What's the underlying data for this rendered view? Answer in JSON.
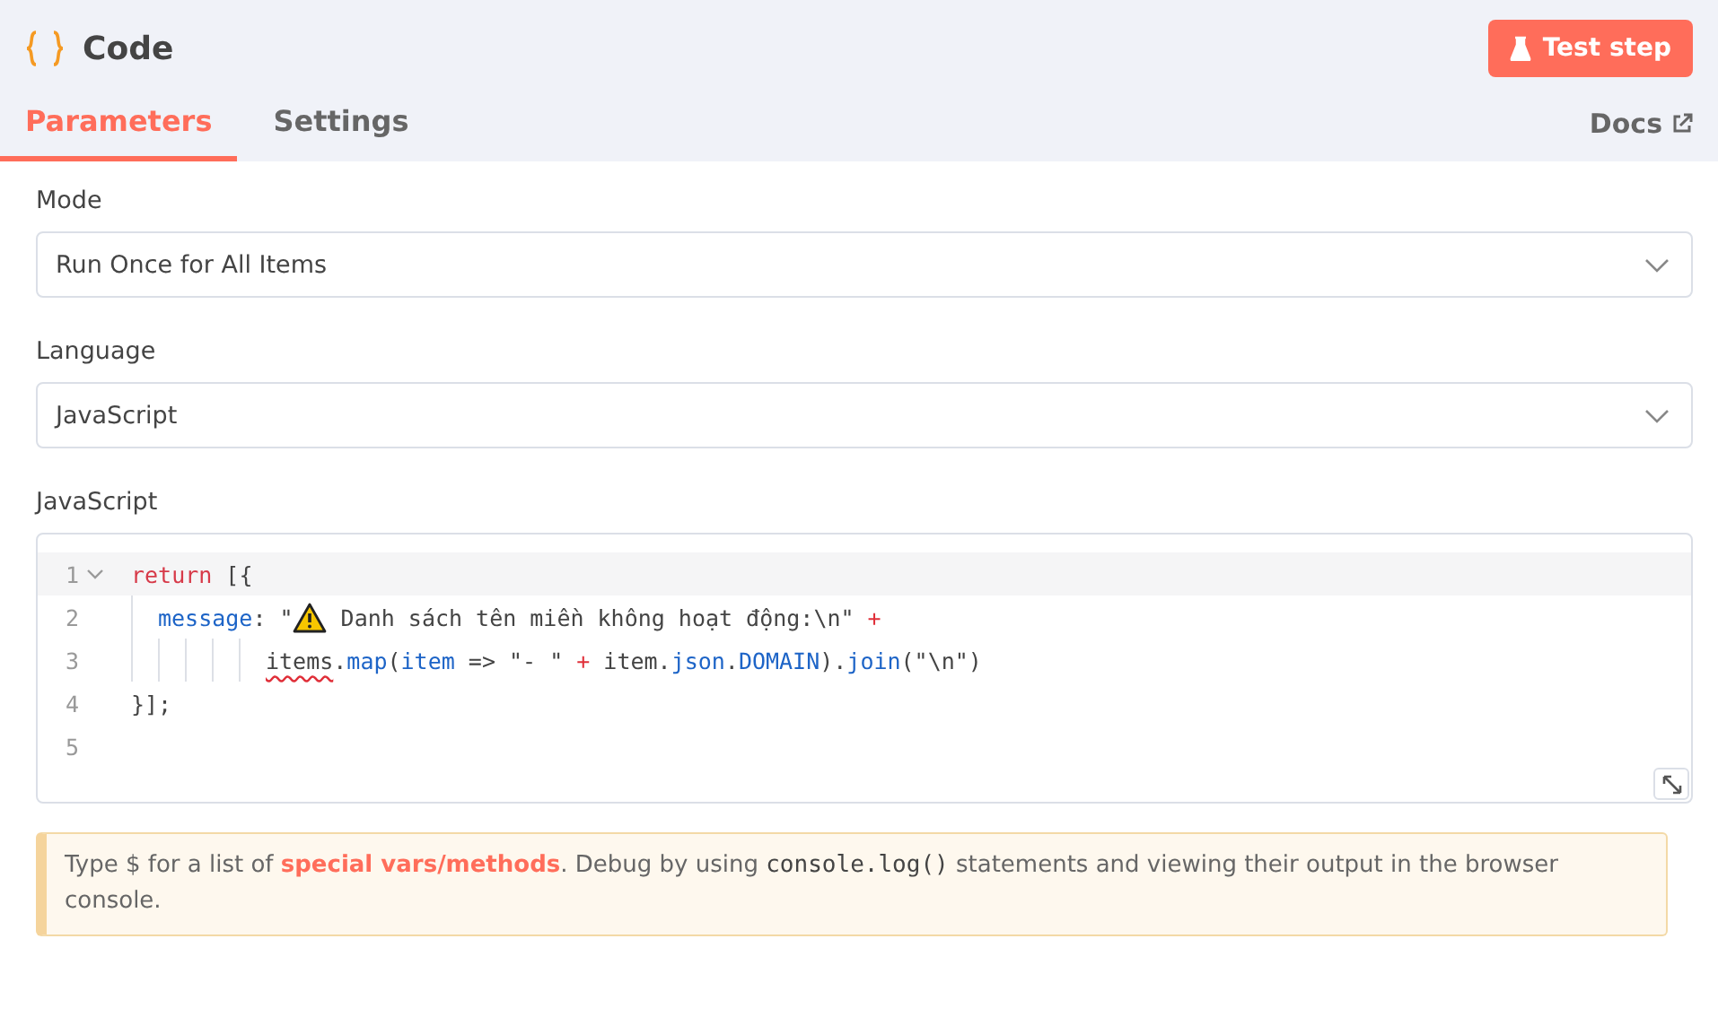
{
  "header": {
    "title": "Code",
    "test_button": "Test step"
  },
  "tabs": [
    {
      "label": "Parameters",
      "selected": true
    },
    {
      "label": "Settings",
      "selected": false
    }
  ],
  "docs_link": "Docs",
  "fields": [
    {
      "label": "Mode",
      "value": "Run Once for All Items"
    },
    {
      "label": "Language",
      "value": "JavaScript"
    }
  ],
  "editor": {
    "label": "JavaScript",
    "lines": [
      {
        "number": "1",
        "active": true,
        "foldable": true,
        "kind": "top",
        "tokens": [
          {
            "kind": "keyword",
            "text": "return"
          },
          {
            "kind": "plain",
            "text": " [{"
          }
        ]
      },
      {
        "number": "2",
        "active": false,
        "foldable": false,
        "kind": "nested",
        "tokens": [
          {
            "kind": "property",
            "text": "message"
          },
          {
            "kind": "plain",
            "text": ": \""
          },
          {
            "kind": "warning"
          },
          {
            "kind": "plain",
            "text": " Danh sách tên miền không hoạt động:\\n\" "
          },
          {
            "kind": "operator",
            "text": "+"
          }
        ]
      },
      {
        "number": "3",
        "active": false,
        "foldable": false,
        "kind": "continuation",
        "tokens": [
          {
            "kind": "error",
            "text": "items"
          },
          {
            "kind": "plain",
            "text": "."
          },
          {
            "kind": "property",
            "text": "map"
          },
          {
            "kind": "plain",
            "text": "("
          },
          {
            "kind": "property",
            "text": "item"
          },
          {
            "kind": "plain",
            "text": " => \"- \" "
          },
          {
            "kind": "operator",
            "text": "+"
          },
          {
            "kind": "plain",
            "text": " item."
          },
          {
            "kind": "property",
            "text": "json"
          },
          {
            "kind": "plain",
            "text": "."
          },
          {
            "kind": "property",
            "text": "DOMAIN"
          },
          {
            "kind": "plain",
            "text": ")."
          },
          {
            "kind": "property",
            "text": "join"
          },
          {
            "kind": "plain",
            "text": "(\"\\n\")"
          }
        ]
      },
      {
        "number": "4",
        "active": false,
        "foldable": false,
        "kind": "top",
        "tokens": [
          {
            "kind": "plain",
            "text": "}];"
          }
        ]
      },
      {
        "number": "5",
        "active": false,
        "foldable": false,
        "kind": "top"
      }
    ]
  },
  "hint": [
    {
      "kind": "text",
      "text": "Type $ for a list of "
    },
    {
      "kind": "link",
      "text": "special vars/methods"
    },
    {
      "kind": "text",
      "text": ". Debug by using "
    },
    {
      "kind": "code",
      "text": "console.log()"
    },
    {
      "kind": "text",
      "text": " statements and viewing their output in the browser console."
    }
  ]
}
